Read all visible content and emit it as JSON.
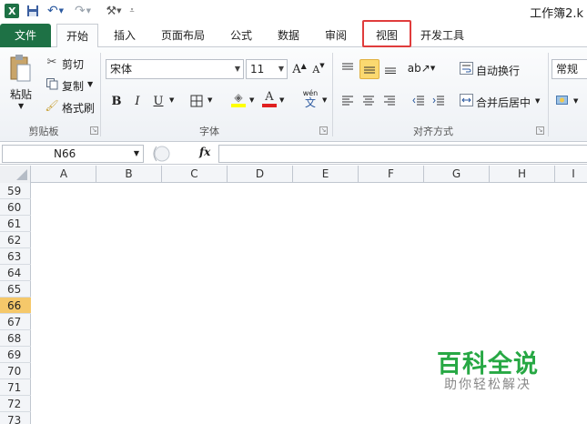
{
  "window": {
    "title": "工作簿2.k"
  },
  "qat": {
    "undo_icon": "undo-icon",
    "redo_icon": "redo-icon",
    "save_icon": "save-icon",
    "excel_icon": "excel-logo"
  },
  "tabs": [
    {
      "label": "文件"
    },
    {
      "label": "开始"
    },
    {
      "label": "插入"
    },
    {
      "label": "页面布局"
    },
    {
      "label": "公式"
    },
    {
      "label": "数据"
    },
    {
      "label": "审阅"
    },
    {
      "label": "视图"
    },
    {
      "label": "开发工具"
    }
  ],
  "ribbon": {
    "clipboard": {
      "paste": "粘贴",
      "cut": "剪切",
      "copy": "复制",
      "format_painter": "格式刷",
      "group": "剪贴板"
    },
    "font": {
      "name": "宋体",
      "size": "11",
      "bold": "B",
      "italic": "I",
      "underline": "U",
      "group": "字体"
    },
    "alignment": {
      "wrap": "自动换行",
      "merge": "合并后居中",
      "group": "对齐方式"
    },
    "number": {
      "format": "常规"
    }
  },
  "formula_bar": {
    "name_box": "N66",
    "fx": "fx"
  },
  "columns": [
    "A",
    "B",
    "C",
    "D",
    "E",
    "F",
    "G",
    "H",
    "I"
  ],
  "rows": [
    "59",
    "60",
    "61",
    "62",
    "63",
    "64",
    "65",
    "66",
    "67",
    "68",
    "69",
    "70",
    "71",
    "72",
    "73"
  ],
  "active_row": "66",
  "watermark": {
    "main": "百科全说",
    "sub": "助你轻松解决"
  },
  "colors": {
    "file_tab": "#1e7145",
    "highlight": "#e03c3c",
    "active_row": "#f5c86a",
    "watermark": "#27a844"
  }
}
